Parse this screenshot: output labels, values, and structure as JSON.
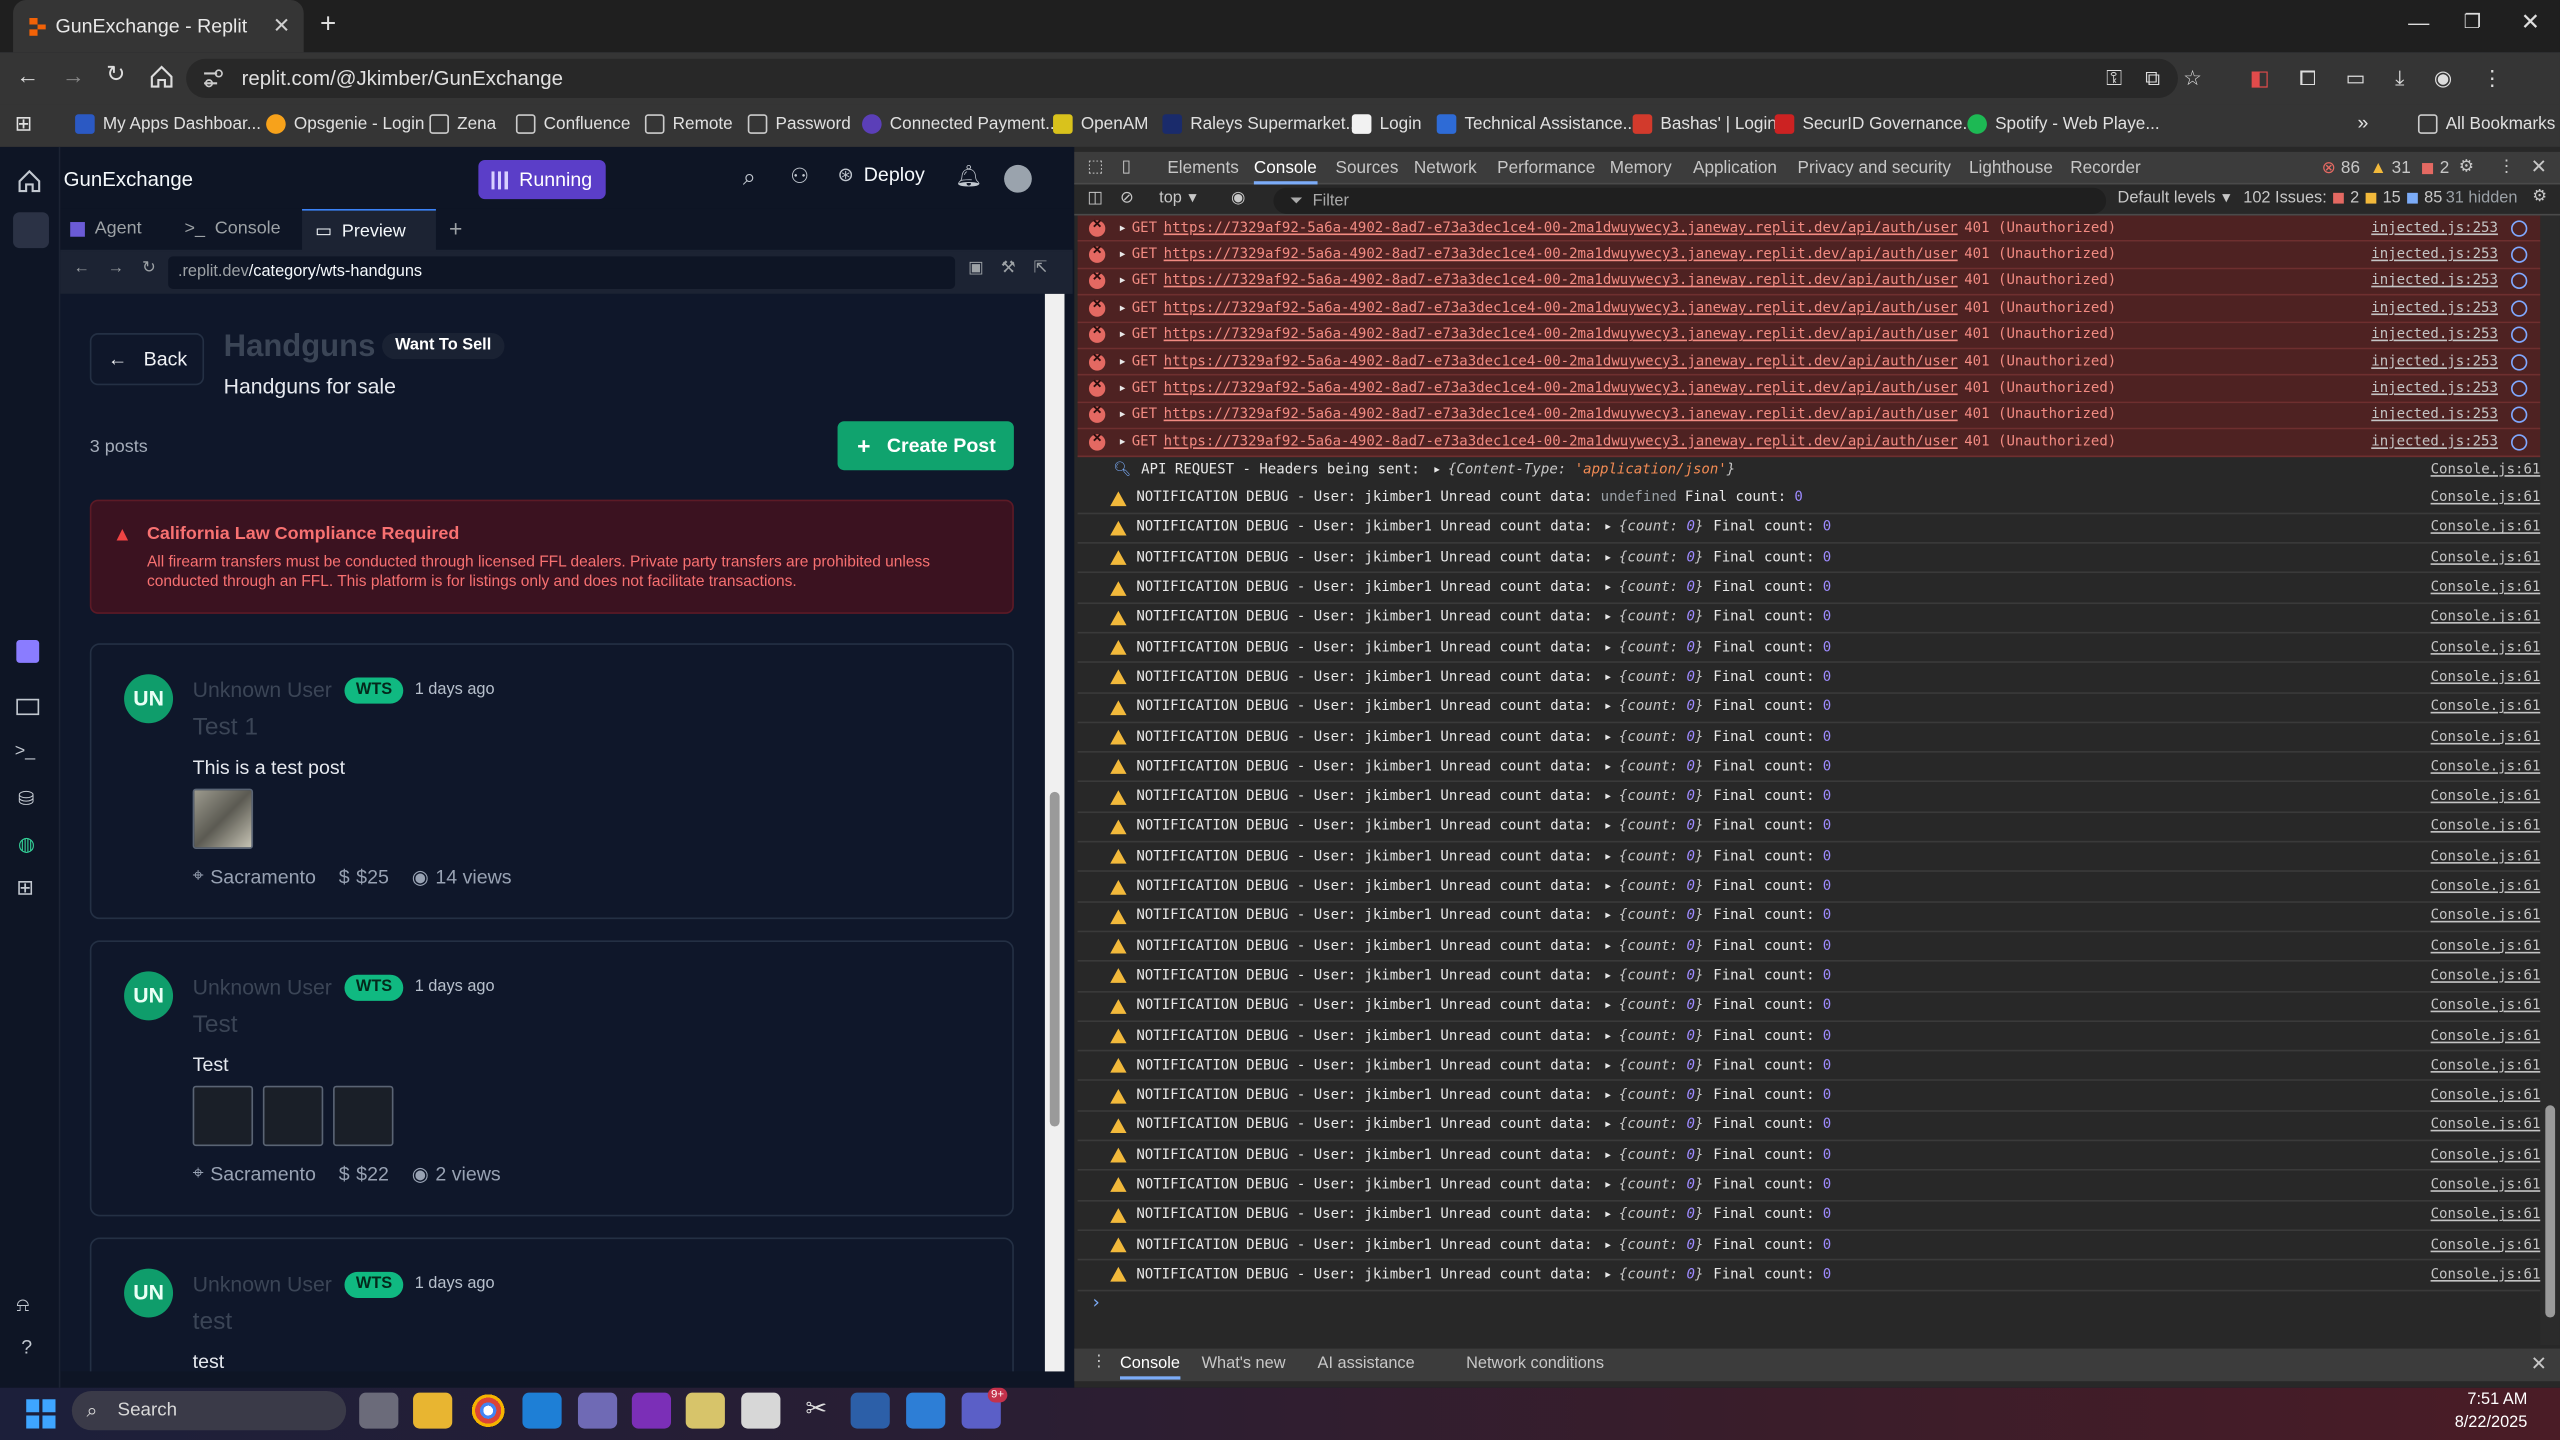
{
  "browser": {
    "tab_title": "GunExchange - Replit",
    "url": "replit.com/@Jkimber/GunExchange",
    "bookmarks": [
      "My Apps Dashboar...",
      "Opsgenie - Login",
      "Zena",
      "Confluence",
      "Remote",
      "Password",
      "Connected Payment...",
      "OpenAM",
      "Raleys Supermarket...",
      "Login",
      "Technical Assistance...",
      "Bashas' | Login",
      "SecurID Governance...",
      "Spotify - Web Playe..."
    ],
    "all_bookmarks": "All Bookmarks"
  },
  "replit": {
    "project_name": "GunExchange",
    "run_status": "Running",
    "deploy_label": "Deploy",
    "tabs": [
      "Agent",
      "Console",
      "Preview"
    ],
    "preview_url_host": ".replit.dev",
    "preview_url_path": "/category/wts-handguns"
  },
  "page": {
    "back_label": "Back",
    "category_title": "Handguns",
    "category_badge": "Want To Sell",
    "category_subtitle": "Handguns for sale",
    "post_count": "3 posts",
    "create_post_label": "Create Post",
    "alert_title": "California Law Compliance Required",
    "alert_body": "All firearm transfers must be conducted through licensed FFL dealers. Private party transfers are prohibited unless conducted through an FFL. This platform is for listings only and does not facilitate transactions.",
    "posts": [
      {
        "initials": "UN",
        "user": "Unknown User",
        "tag": "WTS",
        "age": "1 days ago",
        "title": "Test 1",
        "body": "This is a test post",
        "location": "Sacramento",
        "price": "$25",
        "views": "14 views"
      },
      {
        "initials": "UN",
        "user": "Unknown User",
        "tag": "WTS",
        "age": "1 days ago",
        "title": "Test",
        "body": "Test",
        "location": "Sacramento",
        "price": "$22",
        "views": "2 views"
      },
      {
        "initials": "UN",
        "user": "Unknown User",
        "tag": "WTS",
        "age": "1 days ago",
        "title": "test",
        "body": "test"
      }
    ]
  },
  "devtools": {
    "tabs": [
      "Elements",
      "Console",
      "Sources",
      "Network",
      "Performance",
      "Memory",
      "Application",
      "Privacy and security",
      "Lighthouse",
      "Recorder"
    ],
    "error_count": "86",
    "warning_count": "31",
    "info_count": "2",
    "context": "top",
    "filter_placeholder": "Filter",
    "levels": "Default levels",
    "issues_label": "102 Issues:",
    "issues_err": "2",
    "issues_warn": "15",
    "issues_info": "85",
    "hidden": "31 hidden",
    "error_line": {
      "method": "GET",
      "url": "https://7329af92-5a6a-4902-8ad7-e73a3dec1ce4-00-2ma1dwuywecy3.janeway.replit.dev/api/auth/user",
      "status": "401 (Unauthorized)",
      "source": "injected.js:253"
    },
    "error_repeat": 9,
    "api_line": {
      "text": "API REQUEST - Headers being sent:",
      "obj_key": "Content-Type",
      "obj_val": "'application/json'",
      "source": "Console.js:61"
    },
    "first_warn": {
      "text": "NOTIFICATION DEBUG - User: jkimber1 Unread count data:",
      "undef": "undefined",
      "final": "Final count:",
      "final_val": "0",
      "source": "Console.js:61"
    },
    "warn_line": {
      "text": "NOTIFICATION DEBUG - User: jkimber1 Unread count data:",
      "obj_key": "count",
      "obj_val": "0",
      "final": "Final count:",
      "final_val": "0",
      "source": "Console.js:61"
    },
    "warn_repeat": 26,
    "drawer_tabs": [
      "Console",
      "What's new",
      "AI assistance",
      "Network conditions"
    ]
  },
  "taskbar": {
    "search_placeholder": "Search",
    "time": "7:51 AM",
    "date": "8/22/2025",
    "teams_badge": "9+"
  }
}
